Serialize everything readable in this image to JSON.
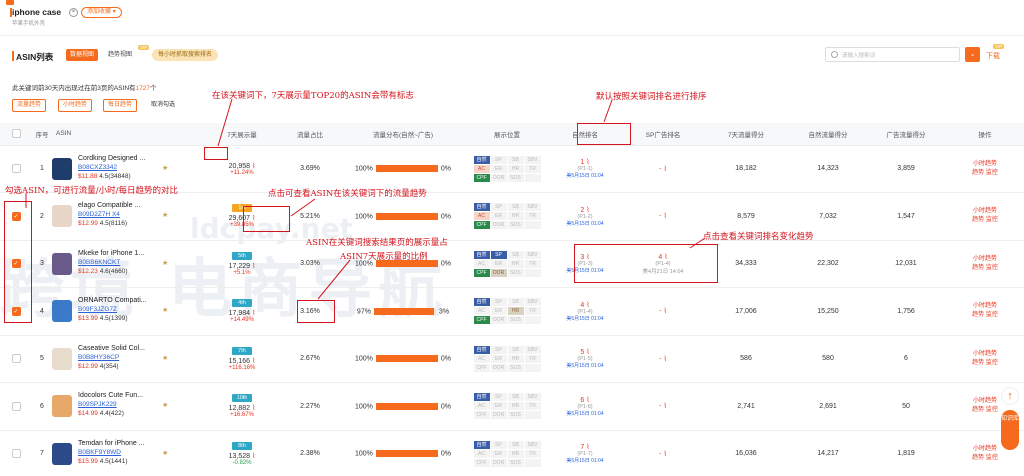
{
  "header": {
    "keyword": "iphone case",
    "favorite_label": "添加收藏 ▾",
    "subtitle": "苹果手机外壳"
  },
  "toolbar": {
    "title": "ASIN列表",
    "tab_data": "数据视图",
    "tab_trend": "趋势视图",
    "hourly_button": "每小时抓取搜索排名",
    "search_placeholder": "请输入搜索词",
    "download": "下载"
  },
  "info": {
    "prefix": "此关键词前30天内出现过在前3页的ASIN有",
    "count": "1727",
    "suffix": "个"
  },
  "buttons": {
    "traffic_trend": "流量趋势",
    "hourly_trend": "小时趋势",
    "daily_trend": "每日趋势",
    "cancel_select": "取消勾选"
  },
  "annotations": {
    "top20": "在该关键词下，7天展示量TOP20的ASIN会带有标志",
    "sort": "默认按照关键词排名进行排序",
    "compare": "勾选ASIN，可进行流量/小时/每日趋势的对比",
    "traffic_click": "点击可查看ASIN在该关键词下的流量趋势",
    "ratio_1": "ASIN在关键词搜索结果页的展示量占",
    "ratio_2": "ASIN7天展示量的比例",
    "rank_trend": "点击查看关键词排名变化趋势"
  },
  "columns": [
    "序号",
    "ASIN",
    "7天展示量",
    "流量占比",
    "流量分布(自然~广告)",
    "展示位置",
    "自然排名",
    "SP广告排名",
    "7天流量得分",
    "自然流量得分",
    "广告流量得分",
    "操作"
  ],
  "position_labels": [
    "自然",
    "SP",
    "SB",
    "SBV",
    "AC",
    "ER",
    "HR",
    "TR",
    "CPF",
    "OOR",
    "SOS",
    ""
  ],
  "rows": [
    {
      "idx": "1",
      "checked": false,
      "title": "Cordking Designed ...",
      "asin": "B08CXZ3342",
      "price": "$11.88",
      "rating": "4.5(34848)",
      "badge": "",
      "impr": "20,958",
      "chg": "+11.24%",
      "chg_dir": "up",
      "share": "3.69%",
      "nat": "100%",
      "nat_frac": 1.0,
      "ad": "0%",
      "pos_on": [
        0,
        4,
        8
      ],
      "rank": "1",
      "rank_sub": "(P1-1)",
      "rank_date": "美5月15日 01:04",
      "sp": "-",
      "sp_sub": "",
      "sp_date": "",
      "s7": "18,182",
      "sn": "14,323",
      "sa": "3,859",
      "thumb": "#1f3d6b"
    },
    {
      "idx": "2",
      "checked": true,
      "title": "elago Compatible ...",
      "asin": "B09D2Z7H X4",
      "price": "$12.99",
      "rating": "4.5(8116)",
      "badge": "1st",
      "impr": "29,607",
      "chg": "+39.85%",
      "chg_dir": "up",
      "share": "5.21%",
      "nat": "100%",
      "nat_frac": 1.0,
      "ad": "0%",
      "pos_on": [
        0,
        4,
        8
      ],
      "rank": "2",
      "rank_sub": "(P1-2)",
      "rank_date": "美5月15日 01:04",
      "sp": "-",
      "sp_sub": "",
      "sp_date": "",
      "s7": "8,579",
      "sn": "7,032",
      "sa": "1,547",
      "thumb": "#e8d6c9"
    },
    {
      "idx": "3",
      "checked": true,
      "title": "Mkeke for iPhone 1...",
      "asin": "B0BB6KNCKT",
      "price": "$12.23",
      "rating": "4.6(4660)",
      "badge": "5th",
      "impr": "17,229",
      "chg": "+5.1%",
      "chg_dir": "up",
      "share": "3.03%",
      "nat": "100%",
      "nat_frac": 1.0,
      "ad": "0%",
      "pos_on": [
        0,
        1,
        8,
        9
      ],
      "rank": "3",
      "rank_sub": "(P1-3)",
      "rank_date": "美5月15日 01:04",
      "sp": "4",
      "sp_sub": "(P1-4)",
      "sp_date": "美4月21日 14:04",
      "s7": "34,333",
      "sn": "22,302",
      "sa": "12,031",
      "thumb": "#6a5a8a"
    },
    {
      "idx": "4",
      "checked": true,
      "title": "ORNARTO Compati...",
      "asin": "B09F3JZG7Z",
      "price": "$13.99",
      "rating": "4.5(1399)",
      "badge": "4th",
      "impr": "17,984",
      "chg": "+14.49%",
      "chg_dir": "up",
      "share": "3.16%",
      "nat": "97%",
      "nat_frac": 0.97,
      "ad": "3%",
      "pos_on": [
        0,
        6,
        8
      ],
      "rank": "4",
      "rank_sub": "(P1-4)",
      "rank_date": "美5月15日 01:04",
      "sp": "-",
      "sp_sub": "",
      "sp_date": "",
      "s7": "17,006",
      "sn": "15,250",
      "sa": "1,756",
      "thumb": "#3a7ac8"
    },
    {
      "idx": "5",
      "checked": false,
      "title": "Caseative Solid Col...",
      "asin": "B0B8HY36CP",
      "price": "$12.99",
      "rating": "4(354)",
      "badge": "7th",
      "impr": "15,166",
      "chg": "+116.16%",
      "chg_dir": "up",
      "share": "2.67%",
      "nat": "100%",
      "nat_frac": 1.0,
      "ad": "0%",
      "pos_on": [
        0
      ],
      "rank": "5",
      "rank_sub": "(P1-5)",
      "rank_date": "美5月15日 01:04",
      "sp": "-",
      "sp_sub": "",
      "sp_date": "",
      "s7": "586",
      "sn": "580",
      "sa": "6",
      "thumb": "#e8dccd"
    },
    {
      "idx": "6",
      "checked": false,
      "title": "Idocolors Cute Fun...",
      "asin": "B09SPJK229",
      "price": "$14.99",
      "rating": "4.4(422)",
      "badge": "10th",
      "impr": "12,882",
      "chg": "+16.67%",
      "chg_dir": "up",
      "share": "2.27%",
      "nat": "100%",
      "nat_frac": 1.0,
      "ad": "0%",
      "pos_on": [
        0
      ],
      "rank": "6",
      "rank_sub": "(P1-6)",
      "rank_date": "美5月15日 01:04",
      "sp": "-",
      "sp_sub": "",
      "sp_date": "",
      "s7": "2,741",
      "sn": "2,691",
      "sa": "50",
      "thumb": "#e8a86a"
    },
    {
      "idx": "7",
      "checked": false,
      "title": "Temdan for iPhone ...",
      "asin": "B0BKF9Y8WD",
      "price": "$15.99",
      "rating": "4.5(1441)",
      "badge": "8th",
      "impr": "13,528",
      "chg": "-0.82%",
      "chg_dir": "down",
      "share": "2.38%",
      "nat": "100%",
      "nat_frac": 1.0,
      "ad": "0%",
      "pos_on": [
        0
      ],
      "rank": "7",
      "rank_sub": "(P1-7)",
      "rank_date": "美5月15日 01:04",
      "sp": "-",
      "sp_sub": "",
      "sp_date": "",
      "s7": "16,036",
      "sn": "14,217",
      "sa": "1,819",
      "thumb": "#2a4a8a"
    }
  ],
  "actions": {
    "hourly": "小时趋势",
    "daily": "趋势",
    "monitor": "监控"
  },
  "side": {
    "knowledge": "知识库"
  }
}
